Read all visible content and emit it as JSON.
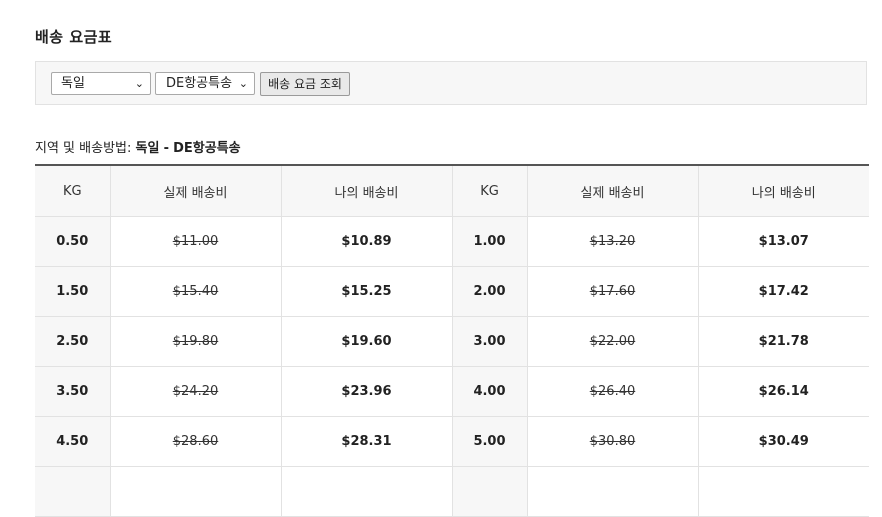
{
  "page": {
    "title": "배송 요금표"
  },
  "filter": {
    "country": "독일",
    "method": "DE항공특송",
    "query_button": "배송 요금 조회"
  },
  "route": {
    "label": "지역 및 배송방법:",
    "country": "독일",
    "separator": "-",
    "method": "DE항공특송"
  },
  "table": {
    "headers": [
      "KG",
      "실제 배송비",
      "나의 배송비",
      "KG",
      "실제 배송비",
      "나의 배송비"
    ],
    "rows": [
      [
        "0.50",
        "$11.00",
        "$10.89",
        "1.00",
        "$13.20",
        "$13.07"
      ],
      [
        "1.50",
        "$15.40",
        "$15.25",
        "2.00",
        "$17.60",
        "$17.42"
      ],
      [
        "2.50",
        "$19.80",
        "$19.60",
        "3.00",
        "$22.00",
        "$21.78"
      ],
      [
        "3.50",
        "$24.20",
        "$23.96",
        "4.00",
        "$26.40",
        "$26.14"
      ],
      [
        "4.50",
        "$28.60",
        "$28.31",
        "5.00",
        "$30.80",
        "$30.49"
      ]
    ]
  }
}
